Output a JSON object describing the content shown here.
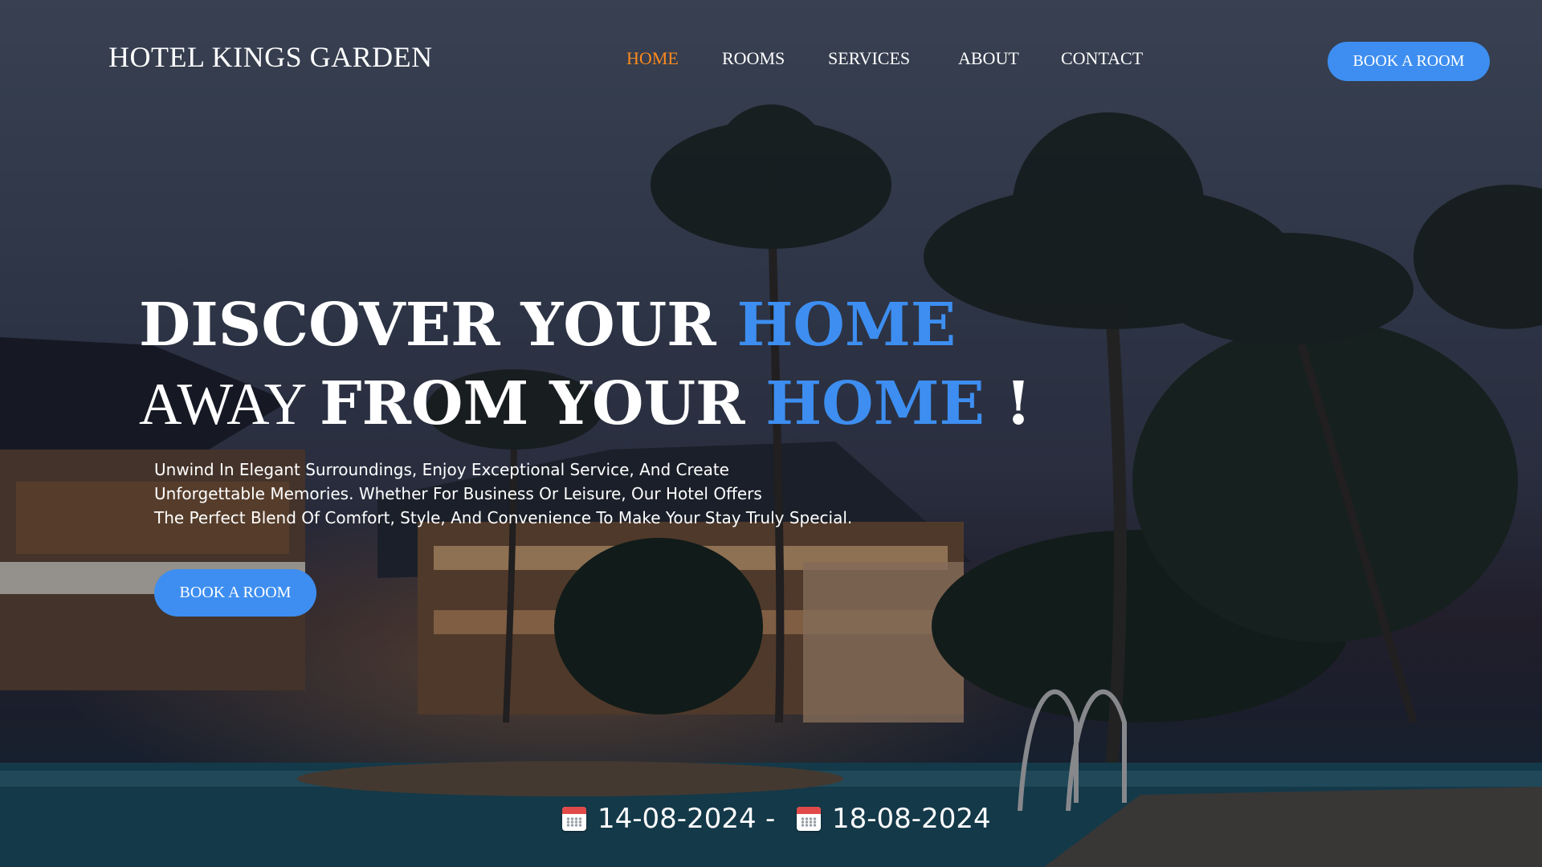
{
  "brand": {
    "name": "HOTEL KINGS GARDEN"
  },
  "nav": {
    "items": [
      {
        "label": "HOME",
        "active": true
      },
      {
        "label": "ROOMS",
        "active": false
      },
      {
        "label": "SERVICES",
        "active": false
      },
      {
        "label": "ABOUT",
        "active": false
      },
      {
        "label": "CONTACT",
        "active": false
      }
    ],
    "book_button": "BOOK A ROOM"
  },
  "hero": {
    "line1": {
      "part1": "DISCOVER YOUR ",
      "accent": "HOME"
    },
    "line2": {
      "part1": "AWAY ",
      "part2": "FROM YOUR ",
      "accent": "HOME",
      "suffix": " !"
    },
    "description": [
      "Unwind In Elegant Surroundings, Enjoy Exceptional Service, And Create",
      "Unforgettable Memories. Whether For Business Or Leisure, Our Hotel Offers",
      "The Perfect Blend Of Comfort, Style, And Convenience To Make Your Stay Truly Special."
    ],
    "book_button": "BOOK A ROOM"
  },
  "dates": {
    "check_in": "14-08-2024",
    "separator": "-",
    "check_out": "18-08-2024",
    "icon": "calendar-icon"
  },
  "colors": {
    "accent": "#3d8ef0",
    "nav_active": "#ff8a1e",
    "text": "#ffffff"
  }
}
